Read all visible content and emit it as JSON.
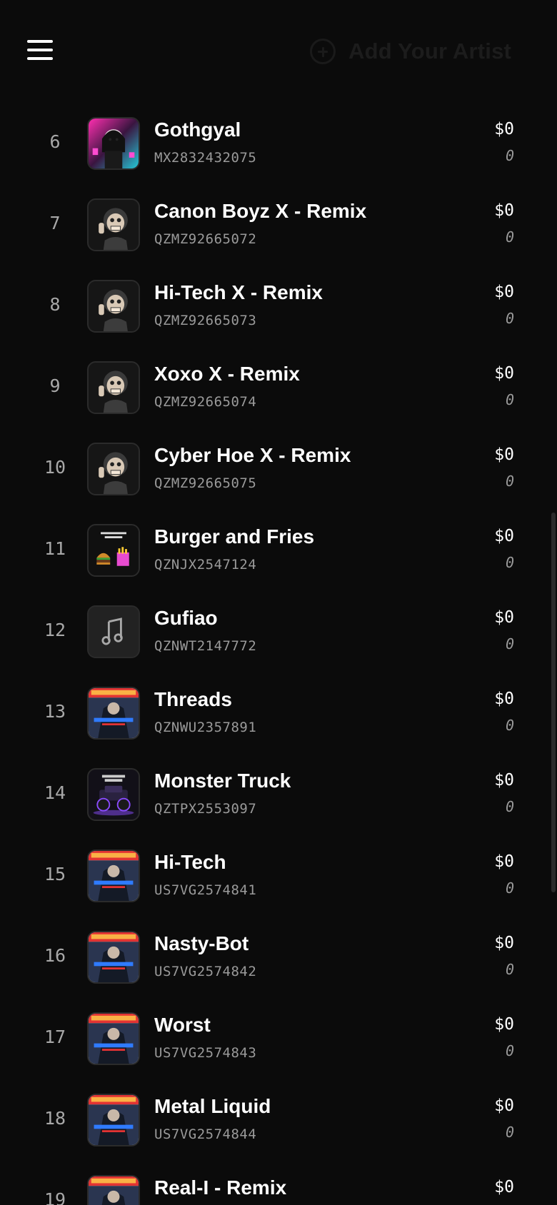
{
  "header": {
    "add_artist_label": "Add Your Artist"
  },
  "icons": {
    "menu": "hamburger-menu-icon",
    "add": "plus-circle-icon",
    "placeholder_art": "music-note-icon"
  },
  "tracks": [
    {
      "rank": "6",
      "title": "Gothgyal",
      "code": "MX2832432075",
      "price": "$0",
      "count": "0",
      "art": "gothgyal"
    },
    {
      "rank": "7",
      "title": "Canon Boyz X - Remix",
      "code": "QZMZ92665072",
      "price": "$0",
      "count": "0",
      "art": "character"
    },
    {
      "rank": "8",
      "title": "Hi-Tech X - Remix",
      "code": "QZMZ92665073",
      "price": "$0",
      "count": "0",
      "art": "character"
    },
    {
      "rank": "9",
      "title": "Xoxo X - Remix",
      "code": "QZMZ92665074",
      "price": "$0",
      "count": "0",
      "art": "character"
    },
    {
      "rank": "10",
      "title": "Cyber Hoe X - Remix",
      "code": "QZMZ92665075",
      "price": "$0",
      "count": "0",
      "art": "character"
    },
    {
      "rank": "11",
      "title": "Burger and Fries",
      "code": "QZNJX2547124",
      "price": "$0",
      "count": "0",
      "art": "burger"
    },
    {
      "rank": "12",
      "title": "Gufiao",
      "code": "QZNWT2147772",
      "price": "$0",
      "count": "0",
      "art": "placeholder"
    },
    {
      "rank": "13",
      "title": "Threads",
      "code": "QZNWU2357891",
      "price": "$0",
      "count": "0",
      "art": "xpeed"
    },
    {
      "rank": "14",
      "title": "Monster Truck",
      "code": "QZTPX2553097",
      "price": "$0",
      "count": "0",
      "art": "truck"
    },
    {
      "rank": "15",
      "title": "Hi-Tech",
      "code": "US7VG2574841",
      "price": "$0",
      "count": "0",
      "art": "xpeed"
    },
    {
      "rank": "16",
      "title": "Nasty-Bot",
      "code": "US7VG2574842",
      "price": "$0",
      "count": "0",
      "art": "xpeed"
    },
    {
      "rank": "17",
      "title": "Worst",
      "code": "US7VG2574843",
      "price": "$0",
      "count": "0",
      "art": "xpeed"
    },
    {
      "rank": "18",
      "title": "Metal Liquid",
      "code": "US7VG2574844",
      "price": "$0",
      "count": "0",
      "art": "xpeed"
    },
    {
      "rank": "19",
      "title": "Real-I - Remix",
      "code": "",
      "price": "$0",
      "count": "",
      "art": "xpeed"
    }
  ],
  "colors": {
    "background": "#0b0b0b",
    "text_primary": "#ffffff",
    "text_secondary": "#9a9a9a",
    "header_action": "#1c1c1c"
  }
}
